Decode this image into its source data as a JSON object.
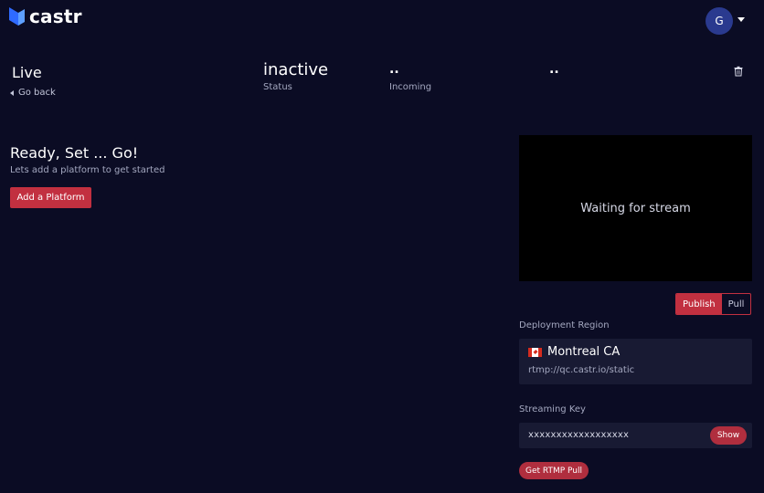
{
  "header": {
    "logo_text": "castr",
    "avatar_initial": "G"
  },
  "page": {
    "title": "Live",
    "go_back_label": "Go back"
  },
  "stats": {
    "status_value": "inactive",
    "status_label": "Status",
    "incoming_value": "..",
    "incoming_label": "Incoming",
    "third_value": ".."
  },
  "main": {
    "ready_title": "Ready, Set ...  Go!",
    "ready_subtitle": "Lets add a platform to get started",
    "add_platform_label": "Add a Platform"
  },
  "preview": {
    "waiting_text": "Waiting for stream"
  },
  "mode_toggle": {
    "publish_label": "Publish",
    "pull_label": "Pull",
    "selected": "Publish"
  },
  "deployment": {
    "label": "Deployment Region",
    "region_name": "Montreal CA",
    "region_url": "rtmp://qc.castr.io/static",
    "flag": "canada-flag-icon"
  },
  "streaming_key": {
    "label": "Streaming Key",
    "masked_value": "xxxxxxxxxxxxxxxxxx",
    "show_label": "Show"
  },
  "rtmp_pull": {
    "label": "Get RTMP Pull"
  },
  "colors": {
    "background": "#0b0c24",
    "accent": "#c23040",
    "card": "#181a33",
    "avatar": "#2a3a8f"
  }
}
